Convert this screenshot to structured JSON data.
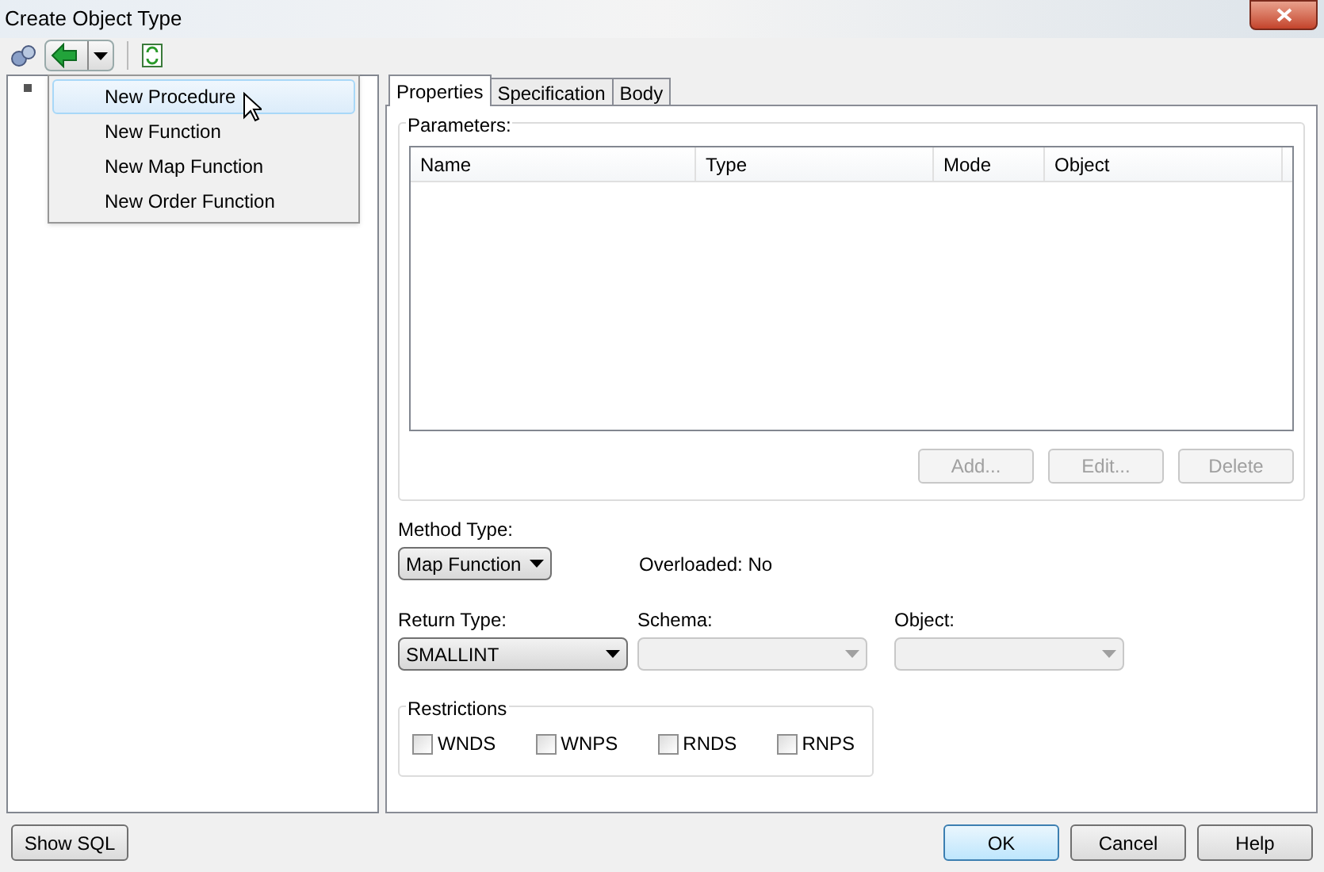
{
  "window": {
    "title": "Create Object Type"
  },
  "menu": [
    {
      "label": "New Procedure",
      "selected": true
    },
    {
      "label": "New Function",
      "selected": false
    },
    {
      "label": "New Map Function",
      "selected": false
    },
    {
      "label": "New Order Function",
      "selected": false
    }
  ],
  "tabs": [
    {
      "label": "Properties",
      "selected": true
    },
    {
      "label": "Specification",
      "selected": false
    },
    {
      "label": "Body",
      "selected": false
    }
  ],
  "parameters": {
    "label": "Parameters:",
    "columns": [
      "Name",
      "Type",
      "Mode",
      "Object"
    ],
    "buttons": [
      {
        "label": "Add...",
        "disabled": true
      },
      {
        "label": "Edit...",
        "disabled": true
      },
      {
        "label": "Delete",
        "disabled": true
      }
    ]
  },
  "method_type": {
    "label": "Method Type:",
    "value": "Map Function"
  },
  "overloaded": "Overloaded: No",
  "return_type": {
    "label": "Return Type:",
    "value": "SMALLINT",
    "disabled": false
  },
  "schema": {
    "label": "Schema:",
    "disabled": true
  },
  "object": {
    "label": "Object:",
    "disabled": true
  },
  "restrictions": {
    "label": "Restrictions",
    "items": [
      {
        "label": "WNDS",
        "checked": false
      },
      {
        "label": "WNPS",
        "checked": false
      },
      {
        "label": "RNDS",
        "checked": false
      },
      {
        "label": "RNPS",
        "checked": false
      }
    ]
  },
  "footer": {
    "left": "Show SQL",
    "buttons": [
      {
        "label": "OK",
        "selected": true
      },
      {
        "label": "Cancel",
        "selected": false
      },
      {
        "label": "Help",
        "selected": false
      }
    ]
  }
}
